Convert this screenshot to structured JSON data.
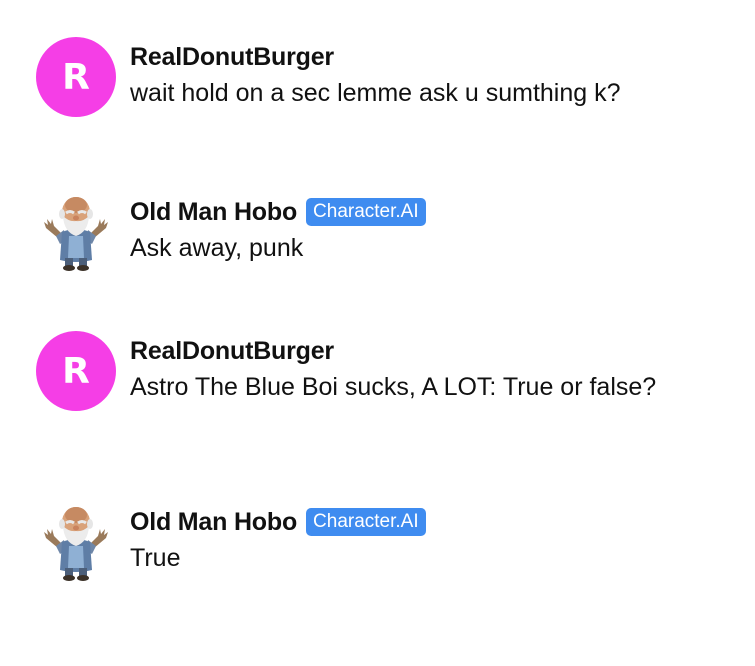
{
  "colors": {
    "user_avatar_bg": "#f53ee6",
    "badge_bg": "#3f8cf0"
  },
  "messages": [
    {
      "author": "RealDonutBurger",
      "avatar_letter": "R",
      "text": "wait hold on a sec lemme ask u sumthing k?"
    },
    {
      "author": "Old Man Hobo",
      "badge": "Character.AI",
      "avatar_icon": "old-man-hobo-avatar",
      "text": "Ask away, punk"
    },
    {
      "author": "RealDonutBurger",
      "avatar_letter": "R",
      "text": "Astro The Blue Boi sucks, A LOT: True or false?"
    },
    {
      "author": "Old Man Hobo",
      "badge": "Character.AI",
      "avatar_icon": "old-man-hobo-avatar",
      "text": "True"
    }
  ]
}
